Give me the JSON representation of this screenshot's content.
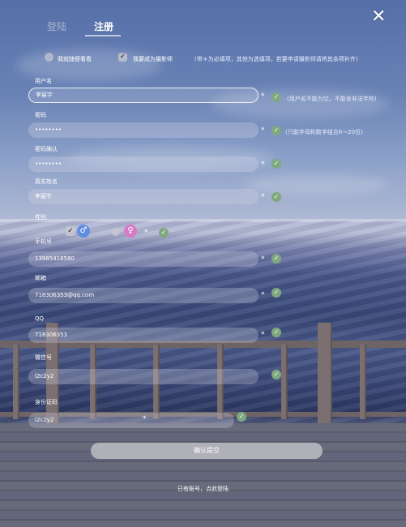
{
  "tabs": {
    "login": "登陆",
    "register": "注册"
  },
  "close_label": "✕",
  "roles": {
    "viewer": "我就随便看看",
    "photographer": "我要成为摄影师"
  },
  "hints": {
    "required_note": "(带＊为必填项，其他为选填项，若要申请摄影师请将其余项补齐)",
    "username": "(用户名不能为空，不能含非法字符)",
    "password": "(只能字母和数字组合6～20位)"
  },
  "fields": {
    "username": {
      "label": "用户名",
      "value": "李宸宇"
    },
    "password": {
      "label": "密码",
      "value": "••••••••"
    },
    "confirm": {
      "label": "密码确认",
      "value": "••••••••"
    },
    "realname": {
      "label": "真实姓名",
      "value": "李宸宇"
    },
    "gender": {
      "label": "性别"
    },
    "phone": {
      "label": "手机号",
      "value": "13985418580"
    },
    "email": {
      "label": "邮箱",
      "value": "718306353@qq.com"
    },
    "qq": {
      "label": "QQ",
      "value": "718306353"
    },
    "wechat": {
      "label": "微信号",
      "value": "l2c2y2"
    },
    "idcard": {
      "label": "身份证码",
      "value": "l2c2y2"
    }
  },
  "required_mark": "*",
  "submit_label": "确认提交",
  "footer_link": "已有账号，点此登陆",
  "icons": {
    "check": "✓",
    "male": "♂",
    "female": "♀"
  },
  "colors": {
    "ok_green": "#7fa87f",
    "male_blue": "#5f8de0",
    "female_pink": "#d47cc6"
  }
}
